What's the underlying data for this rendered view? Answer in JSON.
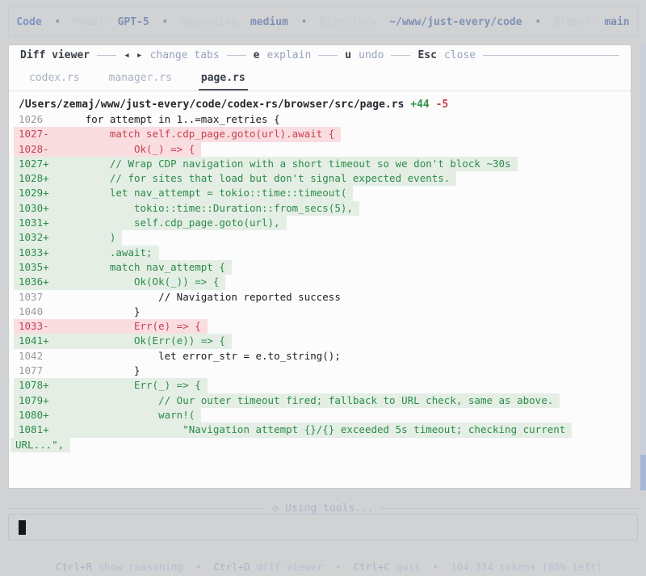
{
  "top_bar": {
    "app_name": "Code",
    "separator": "•",
    "items": [
      {
        "label": "Model:",
        "value": "GPT-5"
      },
      {
        "label": "Reasoning:",
        "value": "medium"
      },
      {
        "label": "Directory:",
        "value": "~/www/just-every/code"
      },
      {
        "label": "Branch:",
        "value": "main"
      }
    ]
  },
  "diff_viewer": {
    "title": "Diff viewer",
    "shortcuts": [
      {
        "key": "◂ ▸",
        "action": "change tabs"
      },
      {
        "key": "e",
        "action": "explain"
      },
      {
        "key": "u",
        "action": "undo"
      },
      {
        "key": "Esc",
        "action": "close"
      }
    ],
    "tabs": [
      {
        "label": "codex.rs",
        "active": false
      },
      {
        "label": "manager.rs",
        "active": false
      },
      {
        "label": "page.rs",
        "active": true
      }
    ],
    "file": {
      "path": "/Users/zemaj/www/just-every/code/codex-rs/browser/src/page.rs",
      "additions": "+44",
      "deletions": "-5"
    },
    "lines": [
      {
        "ln": "1026",
        "marker": " ",
        "type": "ctx",
        "text": "    for attempt in 1..=max_retries {"
      },
      {
        "ln": "1027",
        "marker": "-",
        "type": "del",
        "text": "        match self.cdp_page.goto(url).await {"
      },
      {
        "ln": "1028",
        "marker": "-",
        "type": "del",
        "text": "            Ok(_) => {"
      },
      {
        "ln": "1027",
        "marker": "+",
        "type": "add",
        "text": "        // Wrap CDP navigation with a short timeout so we don't block ~30s"
      },
      {
        "ln": "1028",
        "marker": "+",
        "type": "add",
        "text": "        // for sites that load but don't signal expected events."
      },
      {
        "ln": "1029",
        "marker": "+",
        "type": "add",
        "text": "        let nav_attempt = tokio::time::timeout("
      },
      {
        "ln": "1030",
        "marker": "+",
        "type": "add",
        "text": "            tokio::time::Duration::from_secs(5),"
      },
      {
        "ln": "1031",
        "marker": "+",
        "type": "add",
        "text": "            self.cdp_page.goto(url),"
      },
      {
        "ln": "1032",
        "marker": "+",
        "type": "add",
        "text": "        )"
      },
      {
        "ln": "1033",
        "marker": "+",
        "type": "add",
        "text": "        .await;"
      },
      {
        "ln": "1035",
        "marker": "+",
        "type": "add",
        "text": "        match nav_attempt {"
      },
      {
        "ln": "1036",
        "marker": "+",
        "type": "add",
        "text": "            Ok(Ok(_)) => {"
      },
      {
        "ln": "1037",
        "marker": " ",
        "type": "ctx",
        "text": "                // Navigation reported success"
      },
      {
        "ln": "1040",
        "marker": " ",
        "type": "ctx",
        "text": "            }"
      },
      {
        "ln": "1033",
        "marker": "-",
        "type": "del",
        "text": "            Err(e) => {"
      },
      {
        "ln": "1041",
        "marker": "+",
        "type": "add",
        "text": "            Ok(Err(e)) => {"
      },
      {
        "ln": "1042",
        "marker": " ",
        "type": "ctx",
        "text": "                let error_str = e.to_string();"
      },
      {
        "ln": "1077",
        "marker": " ",
        "type": "ctx",
        "text": "            }"
      },
      {
        "ln": "1078",
        "marker": "+",
        "type": "add",
        "text": "            Err(_) => {"
      },
      {
        "ln": "1079",
        "marker": "+",
        "type": "add",
        "text": "                // Our outer timeout fired; fallback to URL check, same as above."
      },
      {
        "ln": "1080",
        "marker": "+",
        "type": "add",
        "text": "                warn!("
      },
      {
        "ln": "1081",
        "marker": "+",
        "type": "add",
        "text": "                    \"Navigation attempt {}/{} exceeded 5s timeout; checking current"
      },
      {
        "ln": "",
        "marker": "",
        "type": "add",
        "wrap": true,
        "text": "URL...\","
      }
    ]
  },
  "status": {
    "icon": "◇",
    "text": "Using tools..."
  },
  "composer": {
    "value": ""
  },
  "footer": {
    "separator": "•",
    "items": [
      {
        "key": "Ctrl+R",
        "label": "show reasoning"
      },
      {
        "key": "Ctrl+D",
        "label": "diff viewer"
      },
      {
        "key": "Ctrl+C",
        "label": "quit"
      }
    ],
    "tokens": "104,334 tokens (85% left)"
  }
}
